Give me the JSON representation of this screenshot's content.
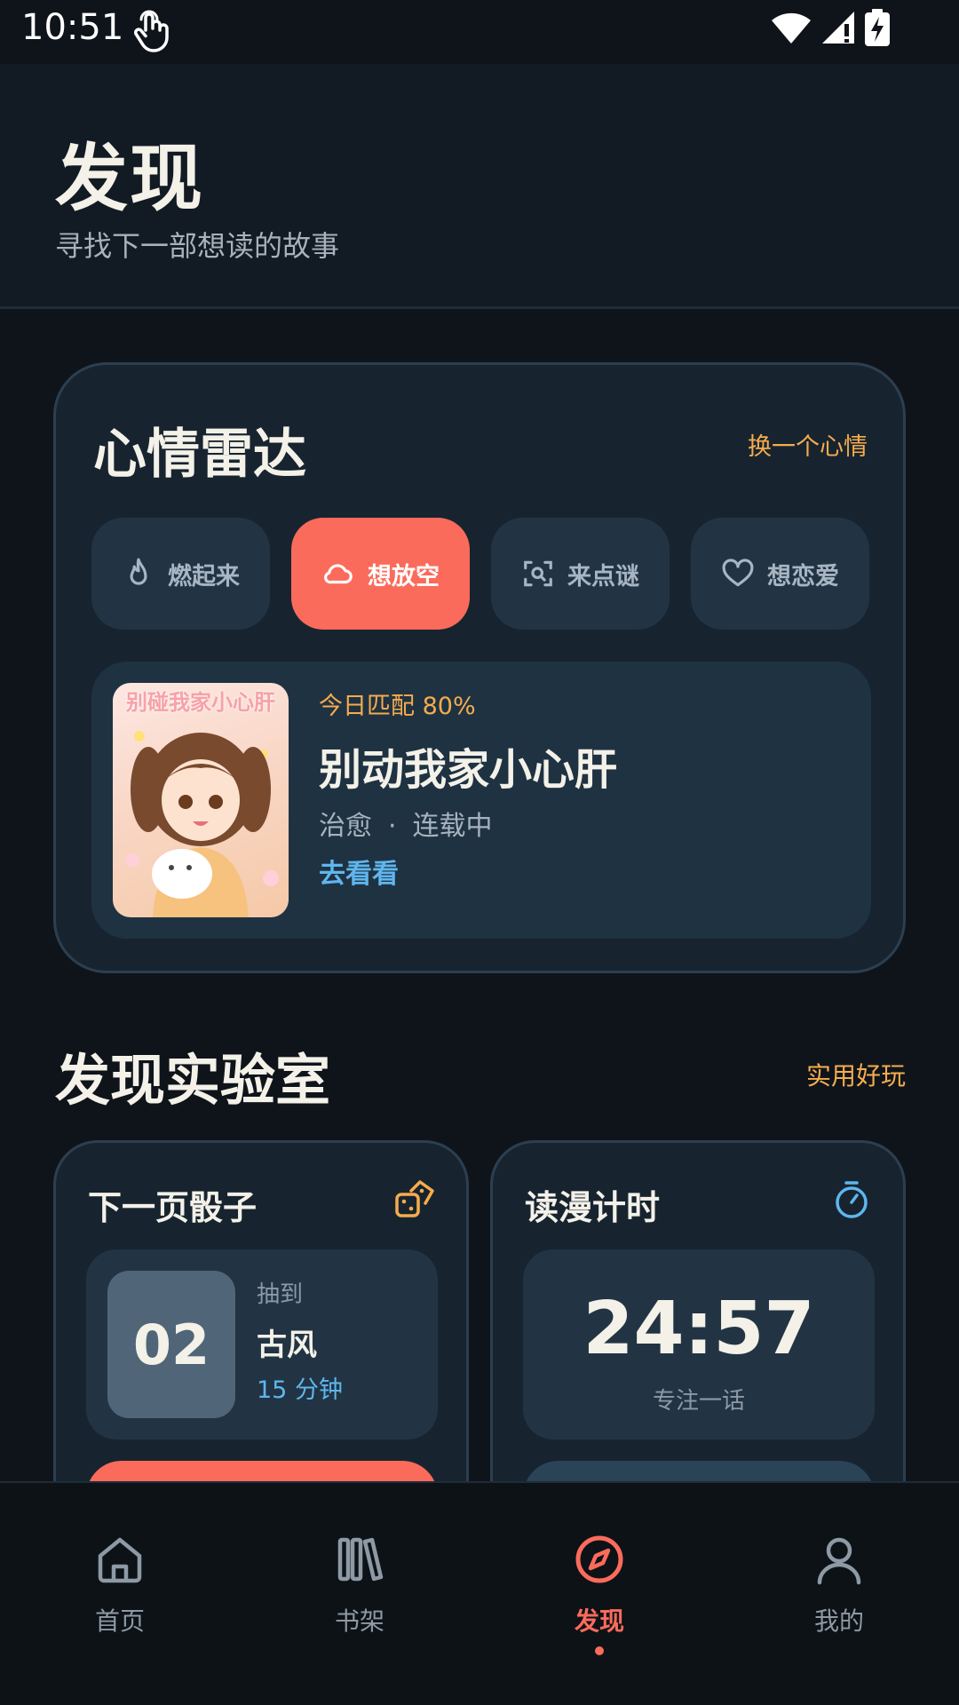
{
  "status": {
    "time": "10:51"
  },
  "header": {
    "title": "发现",
    "subtitle": "寻找下一部想读的故事"
  },
  "mood_radar": {
    "title": "心情雷达",
    "switch_label": "换一个心情",
    "chips": [
      {
        "label": "燃起来",
        "icon": "flame-icon",
        "active": false
      },
      {
        "label": "想放空",
        "icon": "cloud-icon",
        "active": true
      },
      {
        "label": "来点谜",
        "icon": "scan-search-icon",
        "active": false
      },
      {
        "label": "想恋爱",
        "icon": "heart-icon",
        "active": false
      }
    ],
    "match": {
      "cover_title": "别碰我家小心肝",
      "label": "今日匹配  80%",
      "book_title": "别动我家小心肝",
      "genre": "治愈",
      "dot": "·",
      "status": "连载中",
      "action": "去看看"
    }
  },
  "lab": {
    "title": "发现实验室",
    "link": "实用好玩",
    "dice": {
      "title": "下一页骰子",
      "icon": "dice-icon",
      "number": "02",
      "draw_label": "抽到",
      "genre": "古风",
      "duration": "15 分钟"
    },
    "timer": {
      "title": "读漫计时",
      "icon": "stopwatch-icon",
      "value": "24:57",
      "caption": "专注一话"
    }
  },
  "nav": {
    "items": [
      {
        "label": "首页",
        "icon": "home-icon"
      },
      {
        "label": "书架",
        "icon": "bookshelf-icon"
      },
      {
        "label": "发现",
        "icon": "compass-icon",
        "active": true
      },
      {
        "label": "我的",
        "icon": "user-icon"
      }
    ]
  },
  "colors": {
    "accent": "#fb6b5b",
    "highlight": "#f6ac4c",
    "link": "#5fb6ee",
    "background": "#0f141b",
    "card": "#172430"
  }
}
